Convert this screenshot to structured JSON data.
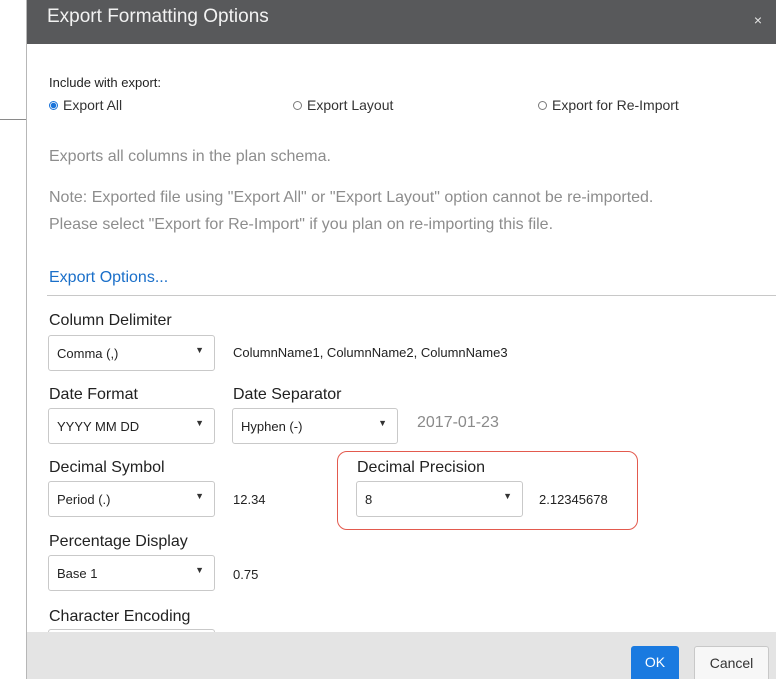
{
  "dialog": {
    "title": "Export Formatting Options",
    "close_glyph": "×"
  },
  "include": {
    "label": "Include with export:",
    "options": [
      {
        "label": "Export All",
        "selected": true
      },
      {
        "label": "Export Layout",
        "selected": false
      },
      {
        "label": "Export for Re-Import",
        "selected": false
      }
    ],
    "description": "Exports all columns in the plan schema.",
    "note_line1": "Note: Exported file using \"Export All\" or \"Export Layout\" option cannot be re-imported.",
    "note_line2": "Please select \"Export for Re-Import\" if you plan on re-importing this file."
  },
  "export_options_link": "Export Options...",
  "fields": {
    "column_delimiter": {
      "label": "Column Delimiter",
      "value": "Comma (,)",
      "preview": "ColumnName1, ColumnName2, ColumnName3"
    },
    "date_format": {
      "label": "Date Format",
      "value": "YYYY MM DD"
    },
    "date_separator": {
      "label": "Date Separator",
      "value": "Hyphen (-)",
      "preview": "2017-01-23"
    },
    "decimal_symbol": {
      "label": "Decimal Symbol",
      "value": "Period (.)",
      "preview": "12.34"
    },
    "decimal_precision": {
      "label": "Decimal Precision",
      "value": "8",
      "preview": "2.12345678"
    },
    "percentage_display": {
      "label": "Percentage Display",
      "value": "Base 1",
      "preview": "0.75"
    },
    "character_encoding": {
      "label": "Character Encoding"
    }
  },
  "buttons": {
    "ok": "OK",
    "cancel": "Cancel"
  },
  "colors": {
    "titlebar": "#58595b",
    "accent": "#1a7ae0",
    "highlight": "#e35a4e",
    "link": "#1a6fc9"
  },
  "icons": {
    "select_caret": "chevron-down-icon",
    "close": "close-icon"
  }
}
